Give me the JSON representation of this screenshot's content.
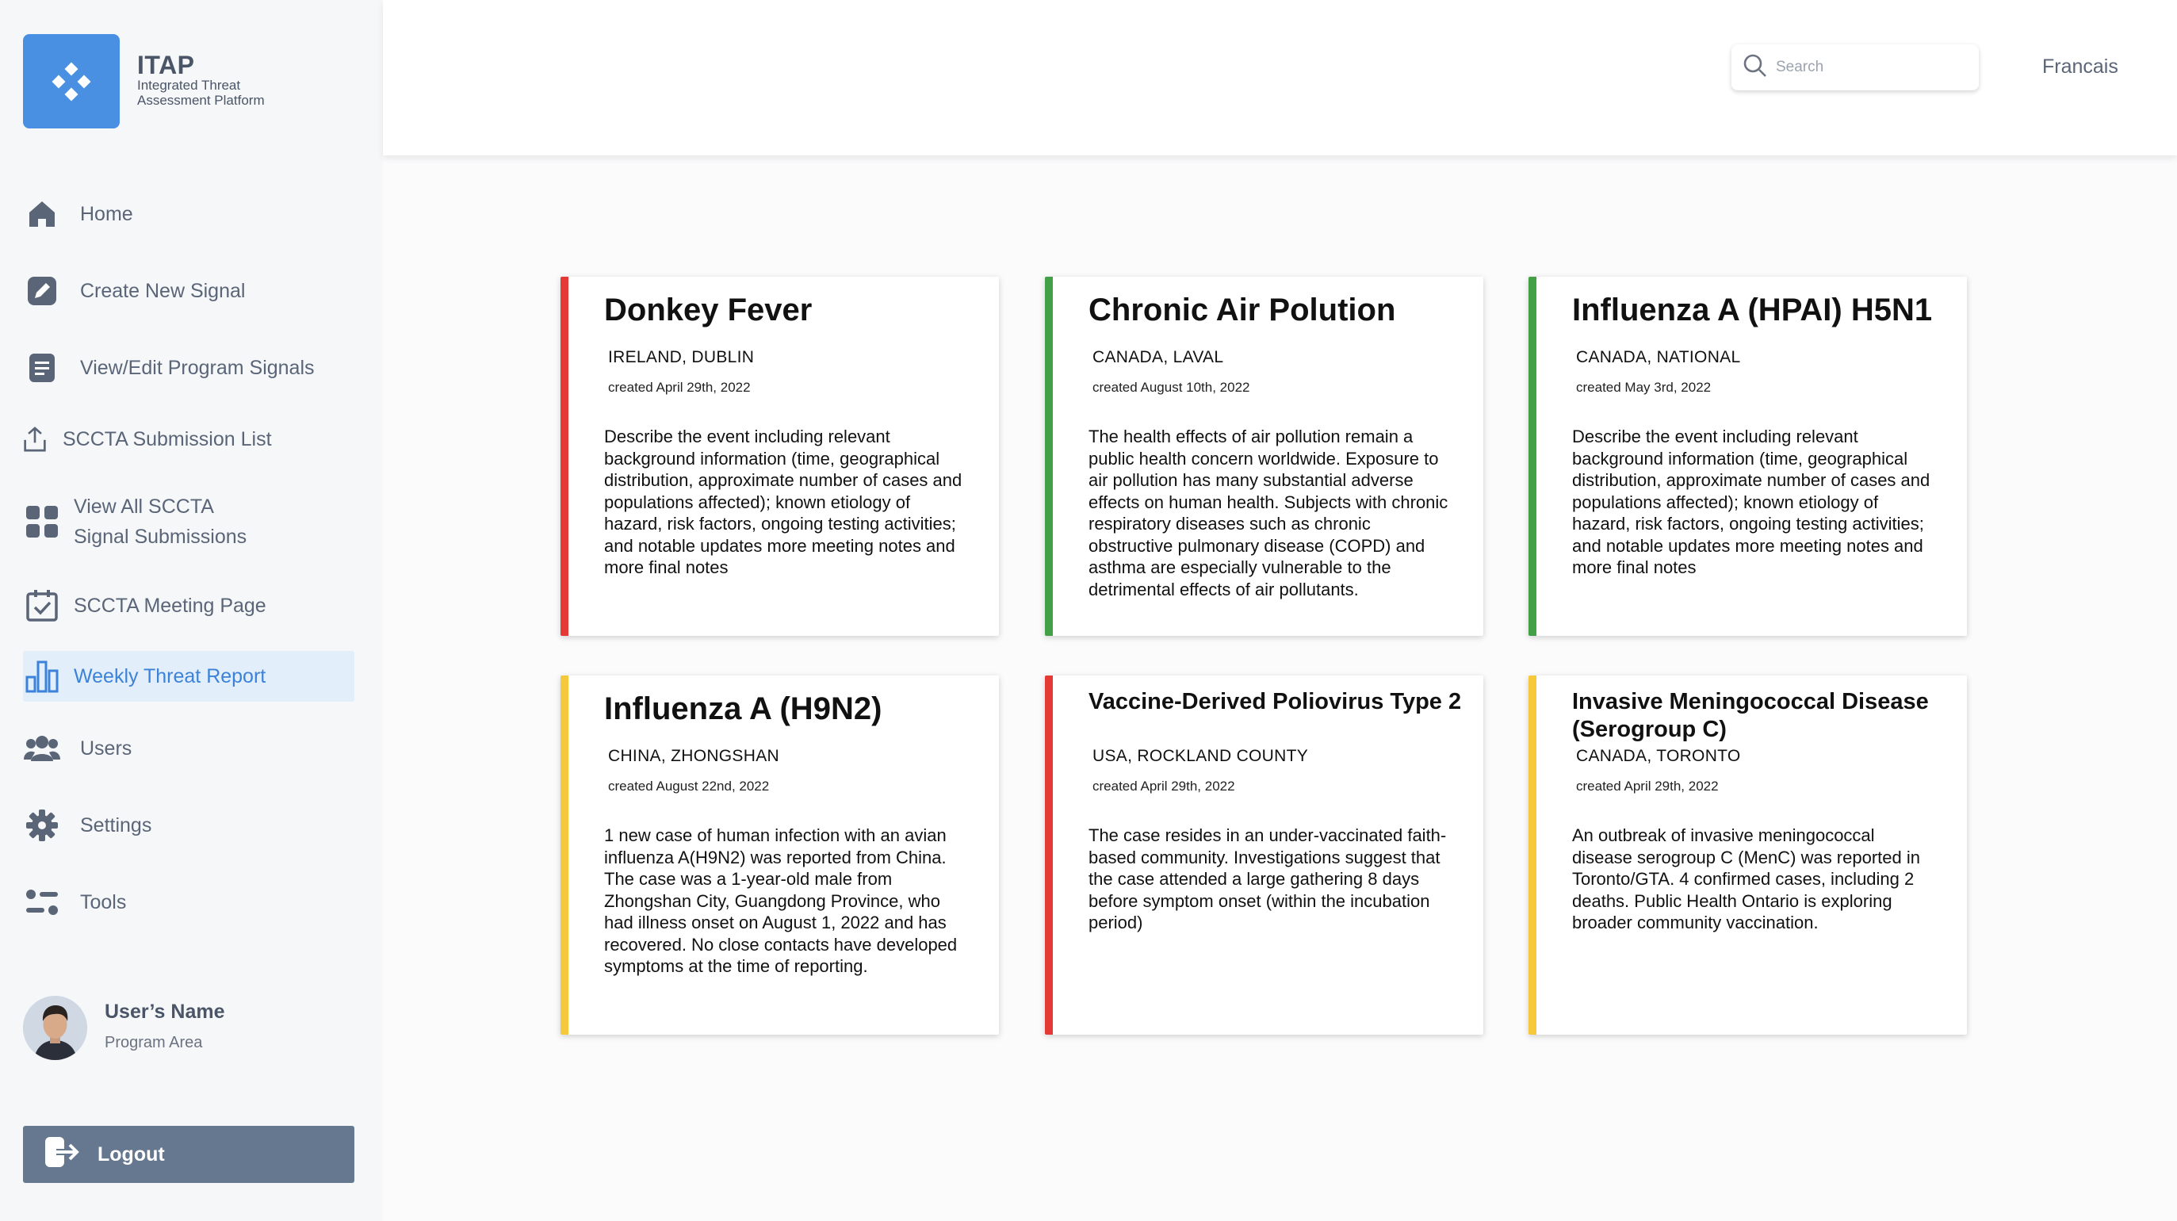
{
  "app": {
    "name": "ITAP",
    "subtitle": "Integrated Threat Assessment Platform"
  },
  "sidebar": {
    "items": [
      {
        "label": "Home",
        "icon": "home-icon"
      },
      {
        "label": "Create New Signal",
        "icon": "pencil-square-icon"
      },
      {
        "label": "View/Edit Program Signals",
        "icon": "document-icon"
      },
      {
        "label": "SCCTA Submission List",
        "icon": "upload-icon"
      },
      {
        "label": "View All SCCTA Signal Submissions",
        "icon": "grid-icon"
      },
      {
        "label": "SCCTA Meeting Page",
        "icon": "calendar-check-icon"
      },
      {
        "label": "Weekly Threat Report",
        "icon": "bar-chart-icon",
        "active": true
      },
      {
        "label": "Users",
        "icon": "users-icon"
      },
      {
        "label": "Settings",
        "icon": "gear-icon"
      },
      {
        "label": "Tools",
        "icon": "tools-icon"
      }
    ],
    "view_all_line1": "View All SCCTA",
    "view_all_line2": "Signal Submissions"
  },
  "user": {
    "name": "User’s Name",
    "area": "Program Area"
  },
  "logout": {
    "label": "Logout"
  },
  "header": {
    "search_placeholder": "Search",
    "language": "Francais"
  },
  "colors": {
    "accent": "#4a90e2",
    "severity_red": "#e53935",
    "severity_green": "#43a047",
    "severity_yellow": "#f5c93b",
    "logout_bg": "#65788f"
  },
  "cards": [
    {
      "title": "Donkey Fever",
      "location": "IRELAND, DUBLIN",
      "created": "created April 29th, 2022",
      "severity": "red",
      "description": "Describe the event including relevant background information (time, geographical distribution, approximate number of cases and populations affected); known etiology of hazard, risk factors, ongoing testing activities; and notable updates more meeting notes and more final notes"
    },
    {
      "title": "Chronic Air Polution",
      "location": "CANADA, LAVAL",
      "created": "created August 10th, 2022",
      "severity": "green",
      "description": "The health effects of air pollution remain a public health concern worldwide. Exposure to air pollution has many substantial adverse effects on human health. Subjects with chronic respiratory diseases such as chronic obstructive pulmonary disease (COPD) and asthma are especially vulnerable to the detrimental effects of air pollutants."
    },
    {
      "title": "Influenza A (HPAI) H5N1",
      "location": "CANADA, NATIONAL",
      "created": "created May 3rd, 2022",
      "severity": "green",
      "description": "Describe the event including relevant background information (time, geographical distribution, approximate number of cases and populations affected); known etiology of hazard, risk factors, ongoing testing activities; and notable updates more meeting notes and more final notes"
    },
    {
      "title": "Influenza A (H9N2)",
      "location": "CHINA, ZHONGSHAN",
      "created": "created August 22nd, 2022",
      "severity": "yellow",
      "description": "1 new case of human infection with an avian influenza A(H9N2) was reported from China. The case was a 1-year-old male from Zhongshan City, Guangdong Province, who had illness onset on August 1, 2022 and has recovered. No close contacts have developed symptoms at the time of reporting."
    },
    {
      "title": "Vaccine-Derived Poliovirus Type 2",
      "location": "USA, ROCKLAND COUNTY",
      "created": "created April 29th, 2022",
      "severity": "red",
      "description": "The case resides in an under-vaccinated faith-based community. Investigations suggest that the case attended a large gathering 8 days before symptom onset (within the incubation period)"
    },
    {
      "title": "Invasive Meningococcal Disease (Serogroup C)",
      "location": "CANADA, TORONTO",
      "created": "created April 29th, 2022",
      "severity": "yellow",
      "description": "An outbreak of invasive meningococcal disease serogroup C (MenC) was reported in Toronto/GTA. 4 confirmed cases, including 2 deaths. Public Health Ontario is exploring broader community vaccination."
    }
  ]
}
